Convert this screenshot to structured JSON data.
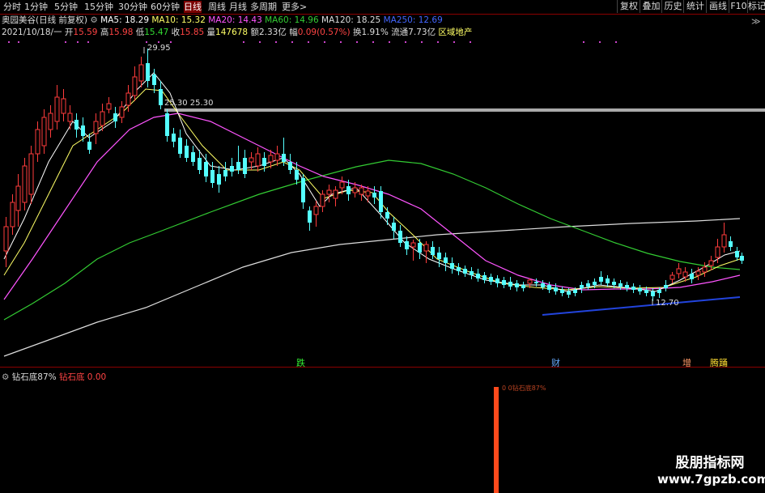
{
  "toolbar": {
    "periods": [
      "分时",
      "1分钟",
      "5分钟",
      "15分钟",
      "30分钟",
      "60分钟",
      "日线",
      "周线",
      "月线",
      "多周期",
      "更多>"
    ],
    "active_period": "日线",
    "right_buttons": [
      "复权",
      "叠加",
      "历史",
      "统计",
      "画线",
      "F10",
      "标记",
      "≫"
    ]
  },
  "info": {
    "stock": "奥园美谷(日线 前复权)",
    "ma5": "MA5: 18.29",
    "ma10": "MA10: 15.32",
    "ma20": "MA20: 14.43",
    "ma60": "MA60: 14.96",
    "ma120": "MA120: 18.25",
    "ma250": "MA250: 12.69",
    "date": "2021/10/18/一",
    "open_label": "开",
    "open": "15.59",
    "high_label": "高",
    "high": "15.98",
    "low_label": "低",
    "low": "15.47",
    "close_label": "收",
    "close": "15.85",
    "volume_label": "量",
    "volume": "147678",
    "amount_label": "额",
    "amount": "2.33亿",
    "change_label": "幅",
    "change": "0.09(0.57%)",
    "turnover": "换1.91%",
    "float_cap": "流通7.73亿",
    "sector": "区域地产"
  },
  "annotations": {
    "high_price": "29.95",
    "resistance": "25.30  25.30",
    "low_price": "12.70",
    "marker_die": "跌",
    "marker_cai": "财",
    "marker_zeng": "增",
    "marker_teng": "腾踊"
  },
  "sub": {
    "title": "钻石底87%",
    "indicator_name": "钻石底",
    "indicator_value": "0.00",
    "bar_label": "0 0钻石底87%"
  },
  "colors": {
    "up": "#ff3c3c",
    "down": "#54ffff",
    "ma5": "#ffffff",
    "ma10": "#ffff66",
    "ma20": "#ff55ff",
    "ma60": "#33cc33",
    "ma120": "#dddddd",
    "ma250": "#4466ff"
  },
  "watermark": {
    "line1": "股朋指标网",
    "line2": "www.7gpzb.com"
  }
}
